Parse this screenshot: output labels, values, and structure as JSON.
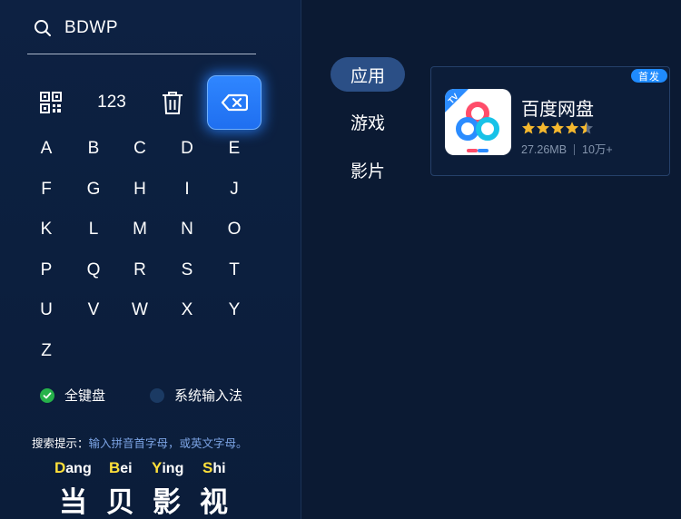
{
  "search": {
    "query": "BDWP"
  },
  "keyboard": {
    "function_keys": {
      "numeric_label": "123"
    },
    "letters": [
      "A",
      "B",
      "C",
      "D",
      "E",
      "F",
      "G",
      "H",
      "I",
      "J",
      "K",
      "L",
      "M",
      "N",
      "O",
      "P",
      "Q",
      "R",
      "S",
      "T",
      "U",
      "V",
      "W",
      "X",
      "Y",
      "Z"
    ],
    "modes": [
      {
        "label": "全键盘",
        "selected": true
      },
      {
        "label": "系统输入法",
        "selected": false
      }
    ]
  },
  "hint": {
    "label": "搜索提示：",
    "text": "输入拼音首字母，或英文字母。"
  },
  "brand": {
    "pinyin": [
      {
        "cap": "D",
        "rest": "ang"
      },
      {
        "cap": "B",
        "rest": "ei"
      },
      {
        "cap": "Y",
        "rest": "ing"
      },
      {
        "cap": "S",
        "rest": "hi"
      }
    ],
    "hanzi": [
      "当",
      "贝",
      "影",
      "视"
    ]
  },
  "categories": [
    {
      "label": "应用",
      "active": true
    },
    {
      "label": "游戏",
      "active": false
    },
    {
      "label": "影片",
      "active": false
    }
  ],
  "results": [
    {
      "name": "百度网盘",
      "badge": "首发",
      "rating": 4.5,
      "size": "27.26MB",
      "downloads": "10万+",
      "icon": "baidu-netdisk-icon"
    }
  ],
  "colors": {
    "accent_blue": "#1f6ff0",
    "pinyin_highlight": "#ffe03a",
    "star_gold": "#f5b82e",
    "selected_green": "#26b24a"
  }
}
